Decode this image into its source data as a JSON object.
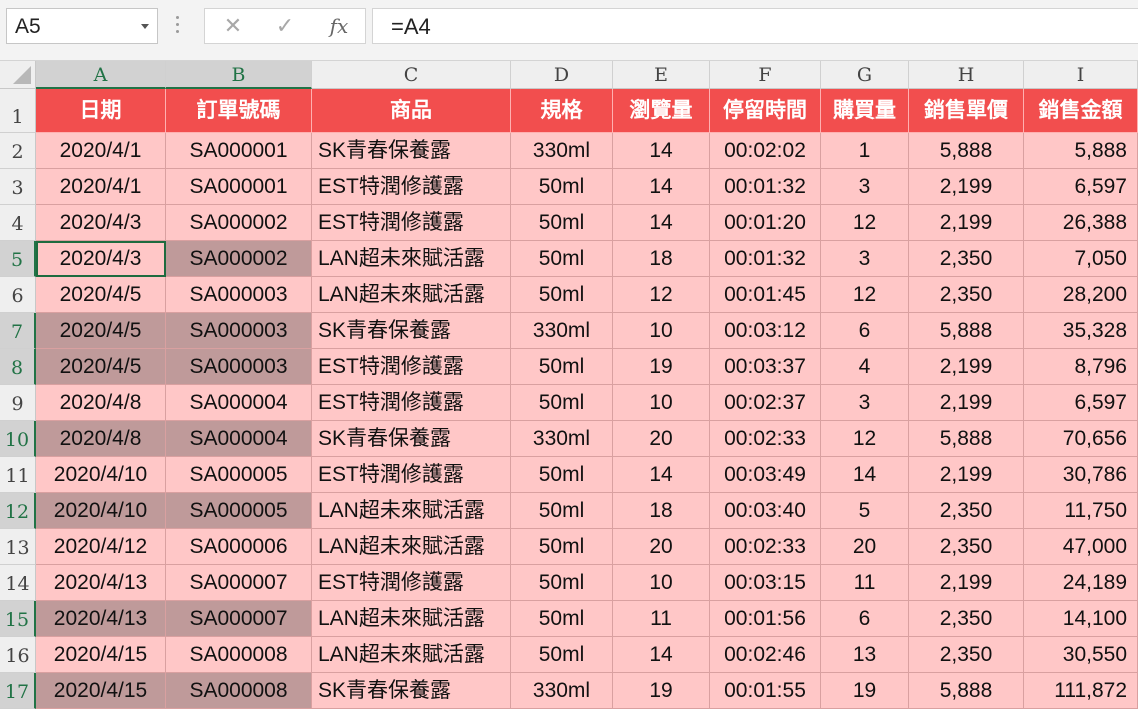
{
  "name_box": "A5",
  "formula": "=A4",
  "formula_buttons": {
    "cancel": "✕",
    "enter": "✓",
    "fx": "fx"
  },
  "column_letters": [
    "A",
    "B",
    "C",
    "D",
    "E",
    "F",
    "G",
    "H",
    "I"
  ],
  "row_numbers": [
    "1",
    "2",
    "3",
    "4",
    "5",
    "6",
    "7",
    "8",
    "9",
    "10",
    "11",
    "12",
    "13",
    "14",
    "15",
    "16",
    "17"
  ],
  "selected_columns": [
    "A",
    "B"
  ],
  "selected_rows": [
    "5",
    "7",
    "8",
    "10",
    "12",
    "15",
    "17"
  ],
  "active_cell": "A5",
  "colors": {
    "header_fill": "#f24e4e",
    "body_fill": "#ffc7c7",
    "selection_fill": "#bf9a9a",
    "accent": "#217346"
  },
  "headers": [
    "日期",
    "訂單號碼",
    "商品",
    "規格",
    "瀏覽量",
    "停留時間",
    "購買量",
    "銷售單價",
    "銷售金額"
  ],
  "rows": [
    [
      "2020/4/1",
      "SA000001",
      "SK青春保養露",
      "330ml",
      "14",
      "00:02:02",
      "1",
      "5,888",
      "5,888"
    ],
    [
      "2020/4/1",
      "SA000001",
      "EST特潤修護露",
      "50ml",
      "14",
      "00:01:32",
      "3",
      "2,199",
      "6,597"
    ],
    [
      "2020/4/3",
      "SA000002",
      "EST特潤修護露",
      "50ml",
      "14",
      "00:01:20",
      "12",
      "2,199",
      "26,388"
    ],
    [
      "2020/4/3",
      "SA000002",
      "LAN超未來賦活露",
      "50ml",
      "18",
      "00:01:32",
      "3",
      "2,350",
      "7,050"
    ],
    [
      "2020/4/5",
      "SA000003",
      "LAN超未來賦活露",
      "50ml",
      "12",
      "00:01:45",
      "12",
      "2,350",
      "28,200"
    ],
    [
      "2020/4/5",
      "SA000003",
      "SK青春保養露",
      "330ml",
      "10",
      "00:03:12",
      "6",
      "5,888",
      "35,328"
    ],
    [
      "2020/4/5",
      "SA000003",
      "EST特潤修護露",
      "50ml",
      "19",
      "00:03:37",
      "4",
      "2,199",
      "8,796"
    ],
    [
      "2020/4/8",
      "SA000004",
      "EST特潤修護露",
      "50ml",
      "10",
      "00:02:37",
      "3",
      "2,199",
      "6,597"
    ],
    [
      "2020/4/8",
      "SA000004",
      "SK青春保養露",
      "330ml",
      "20",
      "00:02:33",
      "12",
      "5,888",
      "70,656"
    ],
    [
      "2020/4/10",
      "SA000005",
      "EST特潤修護露",
      "50ml",
      "14",
      "00:03:49",
      "14",
      "2,199",
      "30,786"
    ],
    [
      "2020/4/10",
      "SA000005",
      "LAN超未來賦活露",
      "50ml",
      "18",
      "00:03:40",
      "5",
      "2,350",
      "11,750"
    ],
    [
      "2020/4/12",
      "SA000006",
      "LAN超未來賦活露",
      "50ml",
      "20",
      "00:02:33",
      "20",
      "2,350",
      "47,000"
    ],
    [
      "2020/4/13",
      "SA000007",
      "EST特潤修護露",
      "50ml",
      "10",
      "00:03:15",
      "11",
      "2,199",
      "24,189"
    ],
    [
      "2020/4/13",
      "SA000007",
      "LAN超未來賦活露",
      "50ml",
      "11",
      "00:01:56",
      "6",
      "2,350",
      "14,100"
    ],
    [
      "2020/4/15",
      "SA000008",
      "LAN超未來賦活露",
      "50ml",
      "14",
      "00:02:46",
      "13",
      "2,350",
      "30,550"
    ],
    [
      "2020/4/15",
      "SA000008",
      "SK青春保養露",
      "330ml",
      "19",
      "00:01:55",
      "19",
      "5,888",
      "111,872"
    ]
  ]
}
